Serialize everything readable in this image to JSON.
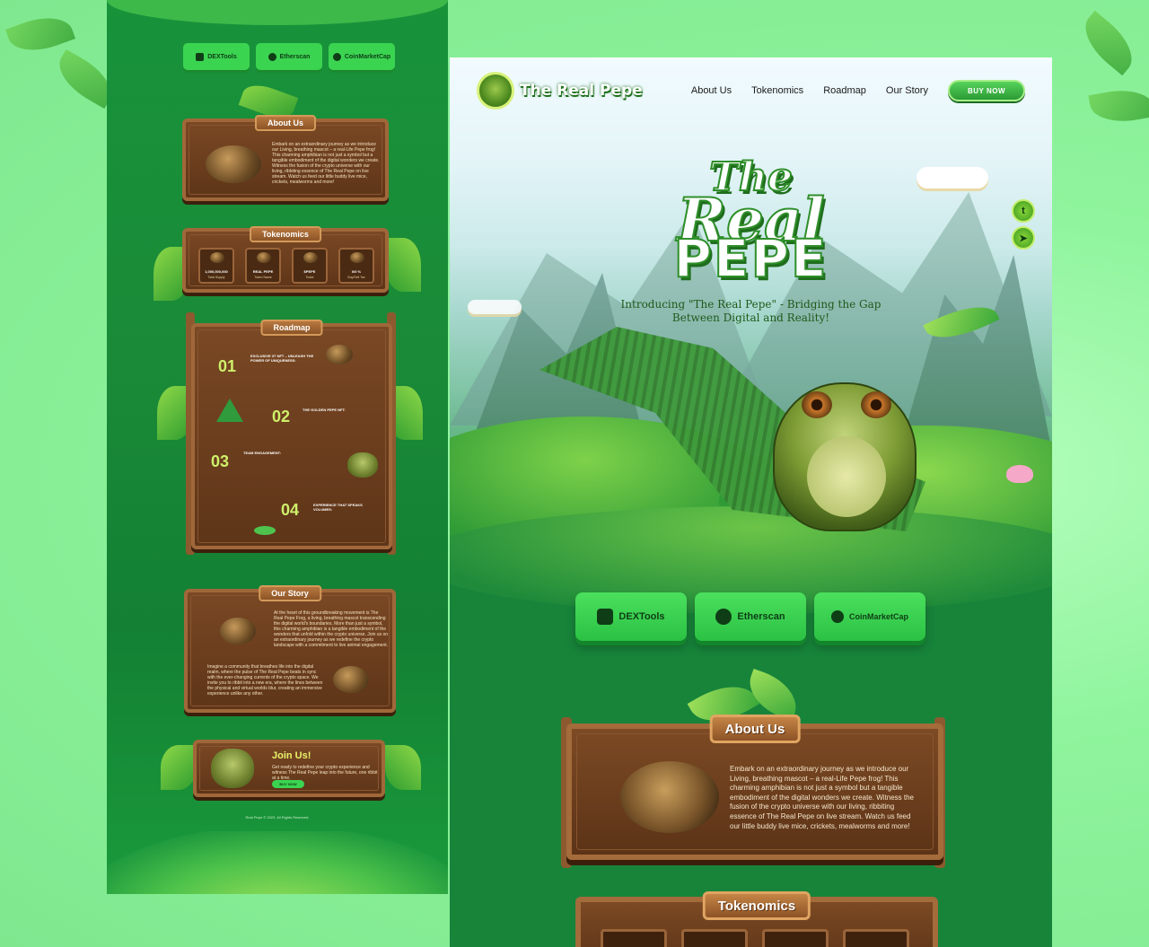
{
  "left_preview": {
    "links": [
      {
        "label": "DEXTools",
        "icon": "dextools-icon"
      },
      {
        "label": "Etherscan",
        "icon": "etherscan-icon"
      },
      {
        "label": "CoinMarketCap",
        "icon": "coinmarketcap-icon"
      }
    ],
    "about": {
      "title": "About Us",
      "text": "Embark on an extraordinary journey as we introduce our Living, breathing mascot – a real-Life Pepe frog! This charming amphibian is not just a symbol but a tangible embodiment of the digital wonders we create. Witness the fusion of the crypto universe with our living, ribbiting essence of The Real Pepe on live stream. Watch us feed our little buddy live mice, crickets, mealworms and more!"
    },
    "tokenomics": {
      "title": "Tokenomics",
      "items": [
        {
          "value": "1,000,000,000",
          "label": "Total Supply"
        },
        {
          "value": "REAL PEPE",
          "label": "Token Name"
        },
        {
          "value": "$PEPE",
          "label": "Ticker"
        },
        {
          "value": "0/0 %",
          "label": "Buy/Sell Tax"
        }
      ]
    },
    "roadmap": {
      "title": "Roadmap",
      "steps": [
        {
          "num": "01",
          "title": "EXCLUSIVE 3T NFT – UNLEASH THE POWER OF UNIQUENESS:"
        },
        {
          "num": "02",
          "title": "THE GOLDEN PEPE NFT:"
        },
        {
          "num": "03",
          "title": "TEAM ENGAGEMENT:"
        },
        {
          "num": "04",
          "title": "EXPERIENCE THAT SPEAKS VOLUMES:"
        }
      ]
    },
    "story": {
      "title": "Our Story",
      "p1": "At the heart of this groundbreaking movement is The Real Pepe Frog, a living, breathing mascot transcending the digital world's boundaries. More than just a symbol, this charming amphibian is a tangible embodiment of the wonders that unfold within the crypto universe. Join us on an extraordinary journey as we redefine the crypto landscape with a commitment to live animal engagement.",
      "p2": "Imagine a community that breathes life into the digital realm, where the pulse of The Real Pepe beats in sync with the ever-changing currents of the crypto space. We invite you to ribbit into a new era, where the lines between the physical and virtual worlds blur, creating an immersive experience unlike any other."
    },
    "join": {
      "title": "Join Us!",
      "text": "Get ready to redefine your crypto experience and witness The Real Pepe leap into the future, one ribbit at a time.",
      "button": "BUY NOW"
    },
    "copyright": "Real Pepe © 2023. All Rights Reserved."
  },
  "hero": {
    "brand": "The Real Pepe",
    "nav": [
      "About Us",
      "Tokenomics",
      "Roadmap",
      "Our Story"
    ],
    "buy_button": "BUY NOW",
    "title_line1": "The",
    "title_line2": "Real",
    "title_line3": "PEPE",
    "tagline_line1": "Introducing \"The Real Pepe\" - Bridging the Gap",
    "tagline_line2": "Between Digital and Reality!",
    "links": [
      {
        "label": "DEXTools",
        "icon": "dextools-icon"
      },
      {
        "label": "Etherscan",
        "icon": "etherscan-icon"
      },
      {
        "label": "CoinMarketCap",
        "icon": "coinmarketcap-icon"
      }
    ],
    "about_title": "About Us",
    "about_text": "Embark on an extraordinary journey as we introduce our Living, breathing mascot – a real-Life Pepe frog! This charming amphibian is not just a symbol but a tangible embodiment of the digital wonders we create. Witness the fusion of the crypto universe with our living, ribbiting essence of The Real Pepe on live stream. Watch us feed our little buddy live mice, crickets, mealworms and more!",
    "tokenomics_title": "Tokenomics",
    "social": [
      "twitter-icon",
      "telegram-icon"
    ]
  },
  "colors": {
    "page_bg": "#8af59a",
    "site_green": "#17843a",
    "button_green": "#3bd451",
    "wood": "#7c4a24",
    "wood_border": "#a46b3b"
  }
}
